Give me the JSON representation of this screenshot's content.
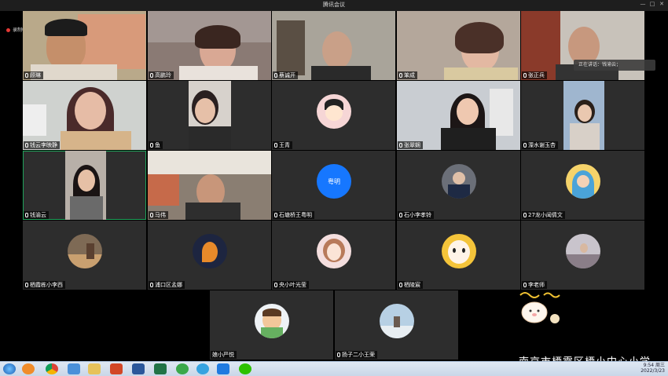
{
  "window": {
    "title": "腾讯会议",
    "minimize": "—",
    "maximize": "□",
    "close": "✕"
  },
  "recording": {
    "label": "录制中"
  },
  "speaking": {
    "label": "正在讲话：钱渝云；"
  },
  "participants": [
    {
      "name": "顾琳"
    },
    {
      "name": "高鹏玲"
    },
    {
      "name": "蔡诚开"
    },
    {
      "name": "笨成"
    },
    {
      "name": "张正兵"
    },
    {
      "name": "钱云李映静"
    },
    {
      "name": "鱼"
    },
    {
      "name": "王青"
    },
    {
      "name": "张翠娴"
    },
    {
      "name": "溧水谢玉杏"
    },
    {
      "name": "钱渝云"
    },
    {
      "name": "马伟"
    },
    {
      "name": "石塘桥王粤明"
    },
    {
      "name": "石小李孝铃"
    },
    {
      "name": "27龙小闻倩文"
    },
    {
      "name": "栖霞栋小李西"
    },
    {
      "name": "浦口区孟娜"
    },
    {
      "name": "央小叶光莹"
    },
    {
      "name": "栖陵宸"
    },
    {
      "name": "李老师"
    },
    {
      "name": "娘小严悦"
    },
    {
      "name": "扬子二小王荣"
    }
  ],
  "initial_avatar": {
    "text": "粤明",
    "color": "#1677ff"
  },
  "watermark": {
    "text": "南京市栖霞区栖小中心小学"
  },
  "clock": {
    "time": "9:54 周三",
    "date": "2022/3/23"
  },
  "taskbar_icons": [
    "start-orb-icon",
    "media-player-icon",
    "chrome-icon",
    "bird-app-icon",
    "file-explorer-icon",
    "powerpoint-icon",
    "word-icon",
    "excel-icon",
    "browser-icon",
    "video-player-icon",
    "tencent-meeting-icon",
    "wechat-icon"
  ]
}
